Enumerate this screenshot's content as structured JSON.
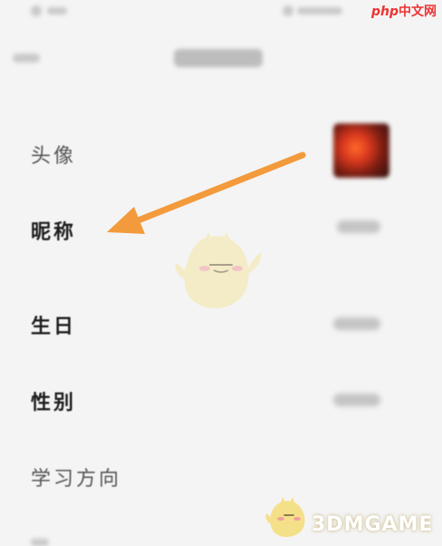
{
  "rows": {
    "avatar_label": "头像",
    "nickname_label": "昵称",
    "birthday_label": "生日",
    "gender_label": "性别",
    "study_direction_label": "学习方向"
  },
  "watermarks": {
    "top_brand_prefix": "php",
    "top_brand_suffix": "中文网",
    "bottom_brand": "3DMGAME"
  },
  "colors": {
    "arrow": "#f39a3c",
    "background": "#f4f4f4",
    "avatar_accent": "#d9381e"
  }
}
